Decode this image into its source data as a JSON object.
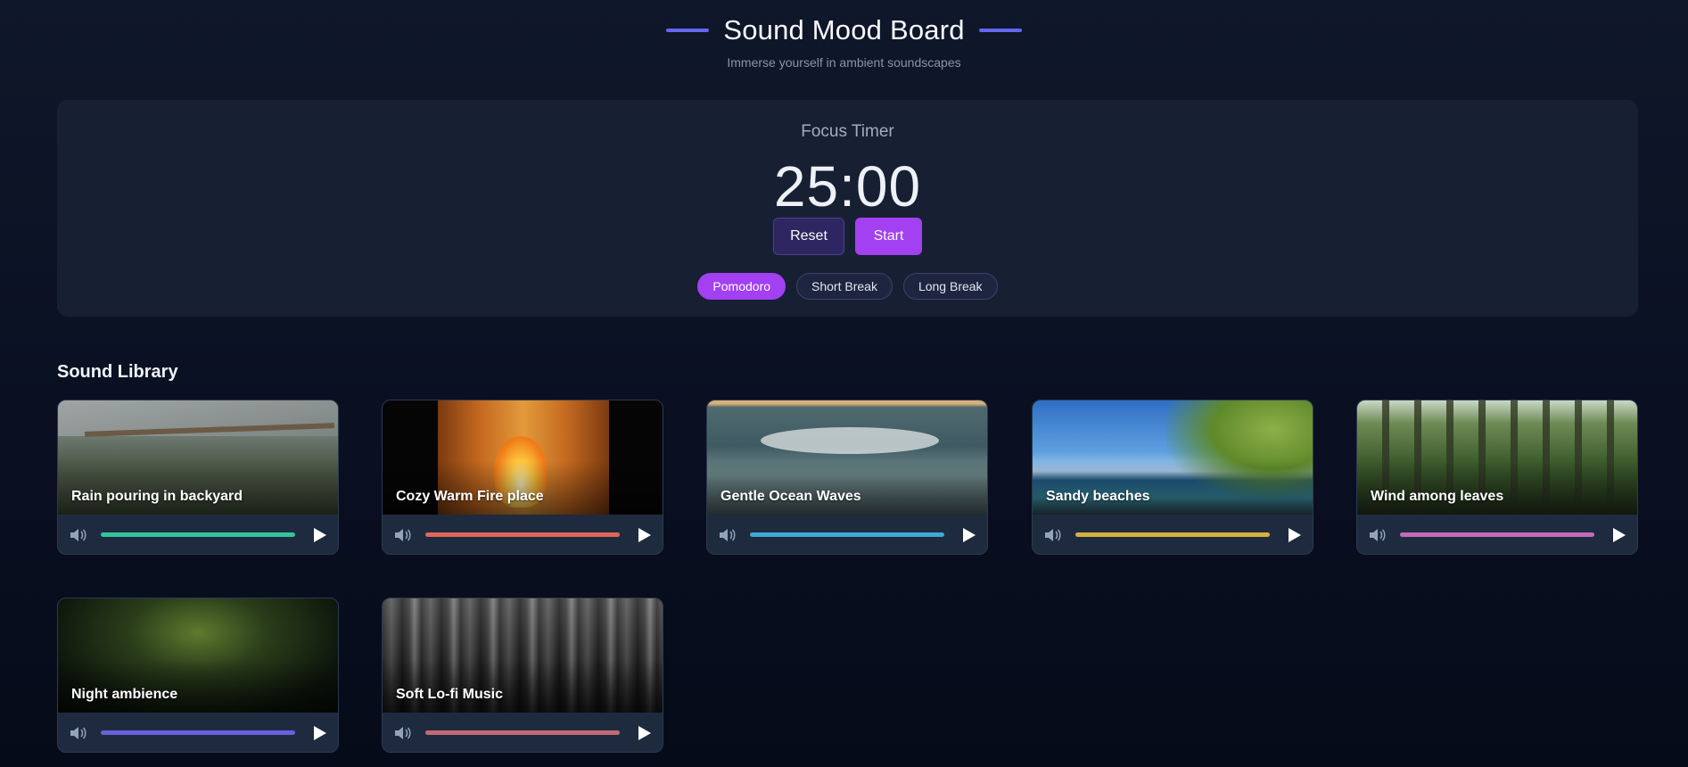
{
  "header": {
    "title": "Sound Mood Board",
    "subtitle": "Immerse yourself in ambient soundscapes",
    "accent_color": "#6366f1"
  },
  "timer": {
    "label": "Focus Timer",
    "display": "25:00",
    "reset_label": "Reset",
    "start_label": "Start",
    "modes": [
      {
        "label": "Pomodoro",
        "active": true
      },
      {
        "label": "Short Break",
        "active": false
      },
      {
        "label": "Long Break",
        "active": false
      }
    ],
    "active_color": "#a340f2"
  },
  "library": {
    "title": "Sound Library",
    "sounds": [
      {
        "title": "Rain pouring in backyard",
        "slider_color": "#34c59a",
        "volume_icon": "volume-icon",
        "play_icon": "play-icon"
      },
      {
        "title": "Cozy Warm Fire place",
        "slider_color": "#e0665a",
        "volume_icon": "volume-icon",
        "play_icon": "play-icon"
      },
      {
        "title": "Gentle Ocean Waves",
        "slider_color": "#3ea8d6",
        "volume_icon": "volume-icon",
        "play_icon": "play-icon"
      },
      {
        "title": "Sandy beaches",
        "slider_color": "#d6b03e",
        "volume_icon": "volume-icon",
        "play_icon": "play-icon"
      },
      {
        "title": "Wind among leaves",
        "slider_color": "#c56ab8",
        "volume_icon": "volume-icon",
        "play_icon": "play-icon"
      },
      {
        "title": "Night ambience",
        "slider_color": "#6a5fdc",
        "volume_icon": "volume-icon",
        "play_icon": "play-icon"
      },
      {
        "title": "Soft Lo-fi Music",
        "slider_color": "#c46a76",
        "volume_icon": "volume-icon",
        "play_icon": "play-icon"
      }
    ]
  }
}
